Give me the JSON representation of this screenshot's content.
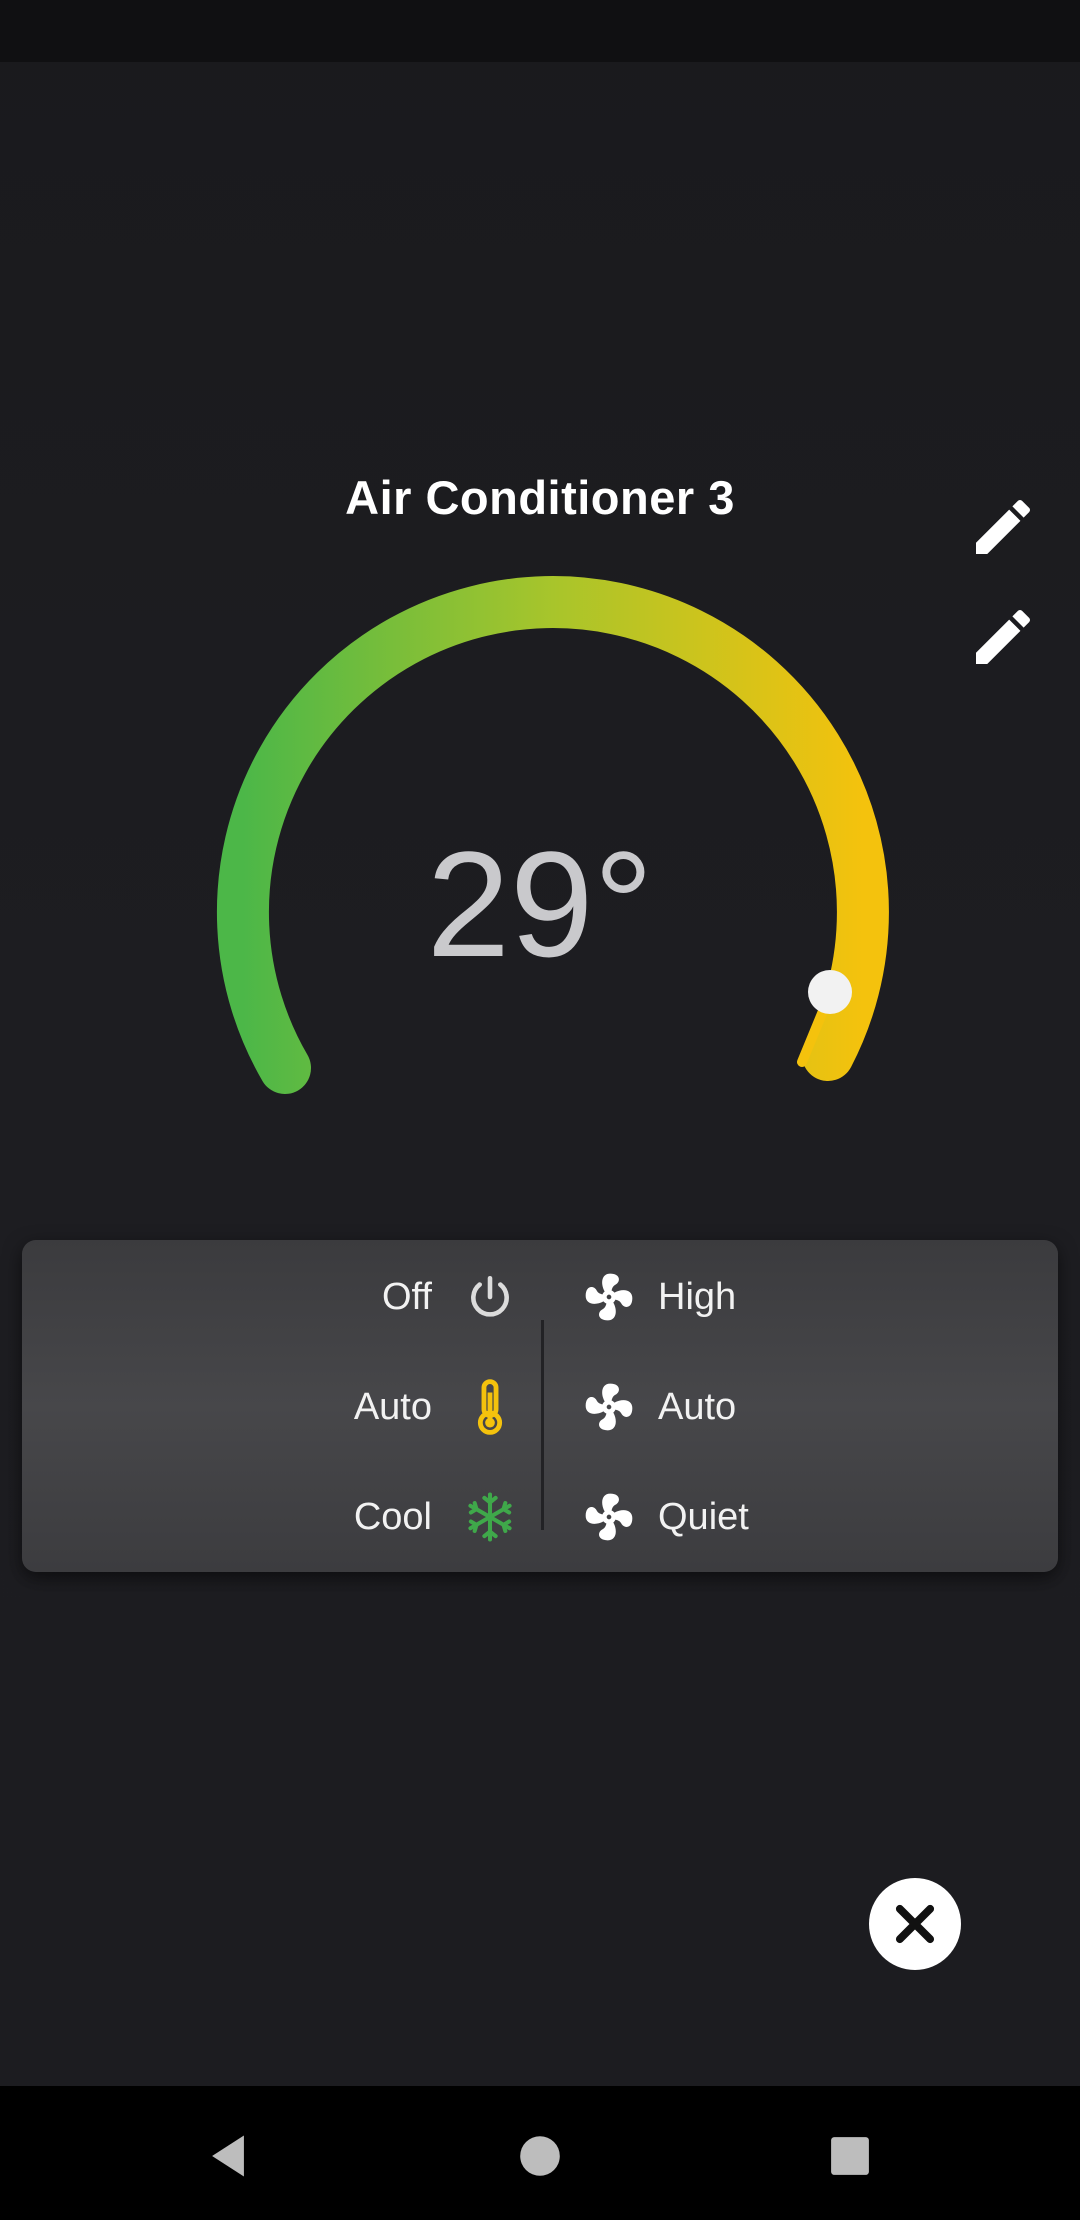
{
  "device": {
    "title": "Air Conditioner 3",
    "temperature": "29°",
    "temperature_value": 29
  },
  "colors": {
    "gauge_start": "#4cb748",
    "gauge_mid": "#a8c52b",
    "gauge_end": "#f4c20d",
    "thermometer": "#f4c20d",
    "snowflake": "#3fa84a",
    "background": "#1c1c20",
    "panel": "#434346"
  },
  "controls": {
    "rows": [
      {
        "mode_label": "Off",
        "mode_icon": "power-icon",
        "fan_label": "High",
        "fan_icon": "fan-icon"
      },
      {
        "mode_label": "Auto",
        "mode_icon": "thermometer-icon",
        "fan_label": "Auto",
        "fan_icon": "fan-icon"
      },
      {
        "mode_label": "Cool",
        "mode_icon": "snowflake-icon",
        "fan_label": "Quiet",
        "fan_icon": "fan-icon"
      }
    ]
  },
  "icons": {
    "edit": "pencil-icon",
    "close": "close-icon",
    "nav_back": "back-triangle-icon",
    "nav_home": "home-circle-icon",
    "nav_recents": "recents-square-icon"
  }
}
